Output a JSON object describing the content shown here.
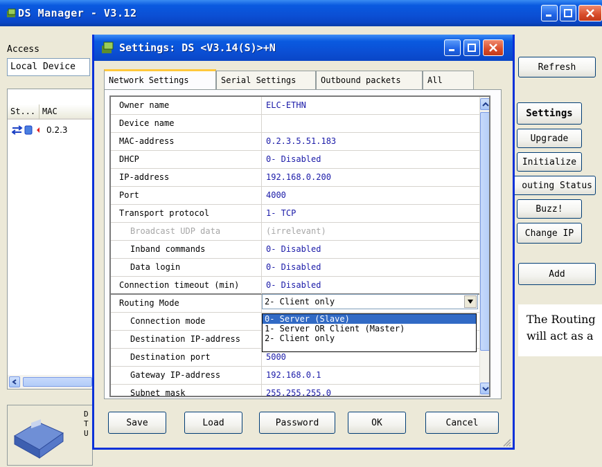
{
  "app": {
    "title": "DS Manager - V3.12"
  },
  "access": {
    "label": "Access",
    "value": "Local Device"
  },
  "list": {
    "col_status": "St...",
    "col_mac": "MAC",
    "row_mac": "0.2.3"
  },
  "buttons": {
    "refresh": "Refresh",
    "settings": "Settings",
    "upgrade": "Upgrade",
    "initialize": "Initialize",
    "routing_status": "outing Status",
    "buzz": "Buzz!",
    "change_ip": "Change IP",
    "add": "Add"
  },
  "info_text": {
    "line1": "The Routing",
    "line2": "will act as a"
  },
  "bottom_panel": {
    "line1": "D",
    "line2": "T",
    "line3": "U"
  },
  "dialog": {
    "title": "Settings: DS <V3.14(S)>+N",
    "tabs": [
      "Network Settings",
      "Serial Settings",
      "Outbound packets",
      "All"
    ],
    "rows": [
      {
        "name": "Owner name",
        "value": "ELC-ETHN"
      },
      {
        "name": "Device name",
        "value": ""
      },
      {
        "name": "MAC-address",
        "value": "0.2.3.5.51.183"
      },
      {
        "name": "DHCP",
        "value": "0- Disabled"
      },
      {
        "name": "IP-address",
        "value": "192.168.0.200"
      },
      {
        "name": "Port",
        "value": "4000"
      },
      {
        "name": "Transport protocol",
        "value": "1- TCP"
      },
      {
        "name": "Broadcast UDP data",
        "value": "(irrelevant)"
      },
      {
        "name": "Inband commands",
        "value": "0- Disabled"
      },
      {
        "name": "Data login",
        "value": "0- Disabled"
      },
      {
        "name": "Connection timeout (min)",
        "value": "0- Disabled"
      },
      {
        "name": "Routing Mode",
        "value": ""
      },
      {
        "name": "Connection mode",
        "value": ""
      },
      {
        "name": "Destination IP-address",
        "value": ""
      },
      {
        "name": "Destination port",
        "value": "5000"
      },
      {
        "name": "Gateway IP-address",
        "value": "192.168.0.1"
      },
      {
        "name": "Subnet mask",
        "value": "255.255.255.0"
      }
    ],
    "routing_combo": {
      "selected": "2- Client only",
      "options": [
        "0- Server (Slave)",
        "1- Server OR Client (Master)",
        "2- Client only"
      ]
    },
    "buttons": {
      "save": "Save",
      "load": "Load",
      "password": "Password",
      "ok": "OK",
      "cancel": "Cancel"
    }
  }
}
